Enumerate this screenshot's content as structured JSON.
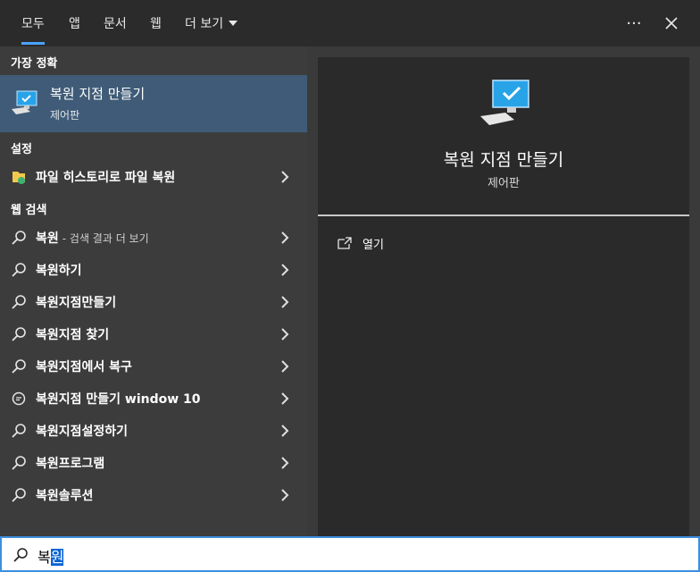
{
  "tabs": [
    {
      "label": "모두",
      "active": true
    },
    {
      "label": "앱"
    },
    {
      "label": "문서"
    },
    {
      "label": "웹"
    },
    {
      "label": "더 보기"
    }
  ],
  "toolbar": {
    "more_icon": "more-icon",
    "close_icon": "close-icon",
    "more_glyph": "···",
    "close_glyph": "✕"
  },
  "left": {
    "best_match_header": "가장 정확",
    "best_match": {
      "title": "복원 지점 만들기",
      "subtitle": "제어판",
      "icon": "control-panel-pc-icon"
    },
    "settings_header": "설정",
    "settings_item": {
      "label": "파일 히스토리로 파일 복원",
      "icon": "file-history-icon"
    },
    "web_header": "웹 검색",
    "web_items": [
      {
        "label": "복원",
        "suffix": "- 검색 결과 더 보기",
        "icon": "search-icon"
      },
      {
        "label": "복원하기",
        "icon": "search-icon"
      },
      {
        "label": "복원지점만들기",
        "icon": "search-icon"
      },
      {
        "label": "복원지점 찾기",
        "icon": "search-icon"
      },
      {
        "label": "복원지점에서 복구",
        "icon": "search-icon"
      },
      {
        "label": "복원지점 만들기 window 10",
        "icon": "chat-bubble-icon"
      },
      {
        "label": "복원지점설정하기",
        "icon": "search-icon"
      },
      {
        "label": "복원프로그램",
        "icon": "search-icon"
      },
      {
        "label": "복원솔루션",
        "icon": "search-icon"
      }
    ]
  },
  "preview": {
    "title": "복원 지점 만들기",
    "subtitle": "제어판",
    "action_open": "열기"
  },
  "search": {
    "typed_plain": "복",
    "typed_selected": "원"
  },
  "colors": {
    "accent": "#4aa3ff",
    "selected_bg": "#3f5b77",
    "search_border": "#3d8fe0"
  }
}
